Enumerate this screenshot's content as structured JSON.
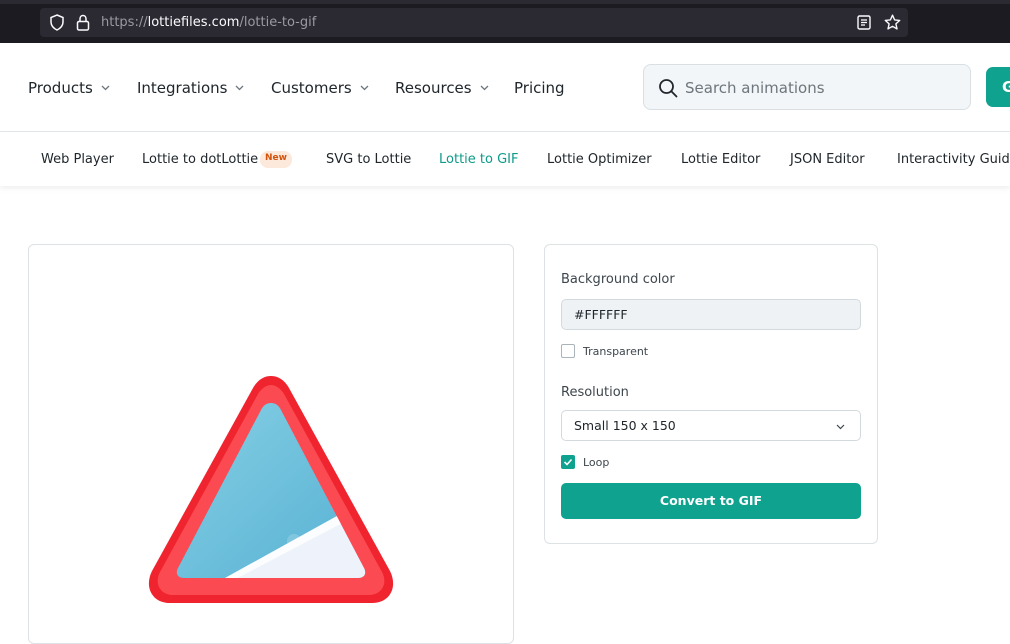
{
  "browser": {
    "url_prefix": "https://",
    "url_host": "lottiefiles.com",
    "url_path": "/lottie-to-gif"
  },
  "nav": {
    "items": [
      {
        "label": "Products",
        "has_dropdown": true
      },
      {
        "label": "Integrations",
        "has_dropdown": true
      },
      {
        "label": "Customers",
        "has_dropdown": true
      },
      {
        "label": "Resources",
        "has_dropdown": true
      },
      {
        "label": "Pricing",
        "has_dropdown": false
      }
    ],
    "search_placeholder": "Search animations",
    "cta_label": "G"
  },
  "subnav": {
    "items": [
      {
        "label": "Web Player"
      },
      {
        "label": "Lottie to dotLottie"
      },
      {
        "label": "SVG to Lottie"
      },
      {
        "label": "Lottie to GIF",
        "active": true
      },
      {
        "label": "Lottie Optimizer"
      },
      {
        "label": "Lottie Editor"
      },
      {
        "label": "JSON Editor"
      },
      {
        "label": "Interactivity Guide"
      }
    ],
    "new_badge": "New"
  },
  "settings": {
    "background_label": "Background color",
    "background_value": "#FFFFFF",
    "transparent_label": "Transparent",
    "transparent_checked": false,
    "resolution_label": "Resolution",
    "resolution_value": "Small 150 x 150",
    "loop_label": "Loop",
    "loop_checked": true,
    "convert_label": "Convert to GIF"
  },
  "colors": {
    "accent": "#0fa28f",
    "active_link": "#0d9b8a",
    "badge_bg": "#fde8dc",
    "badge_text": "#d4530c",
    "triangle_red": "#f0242f"
  }
}
